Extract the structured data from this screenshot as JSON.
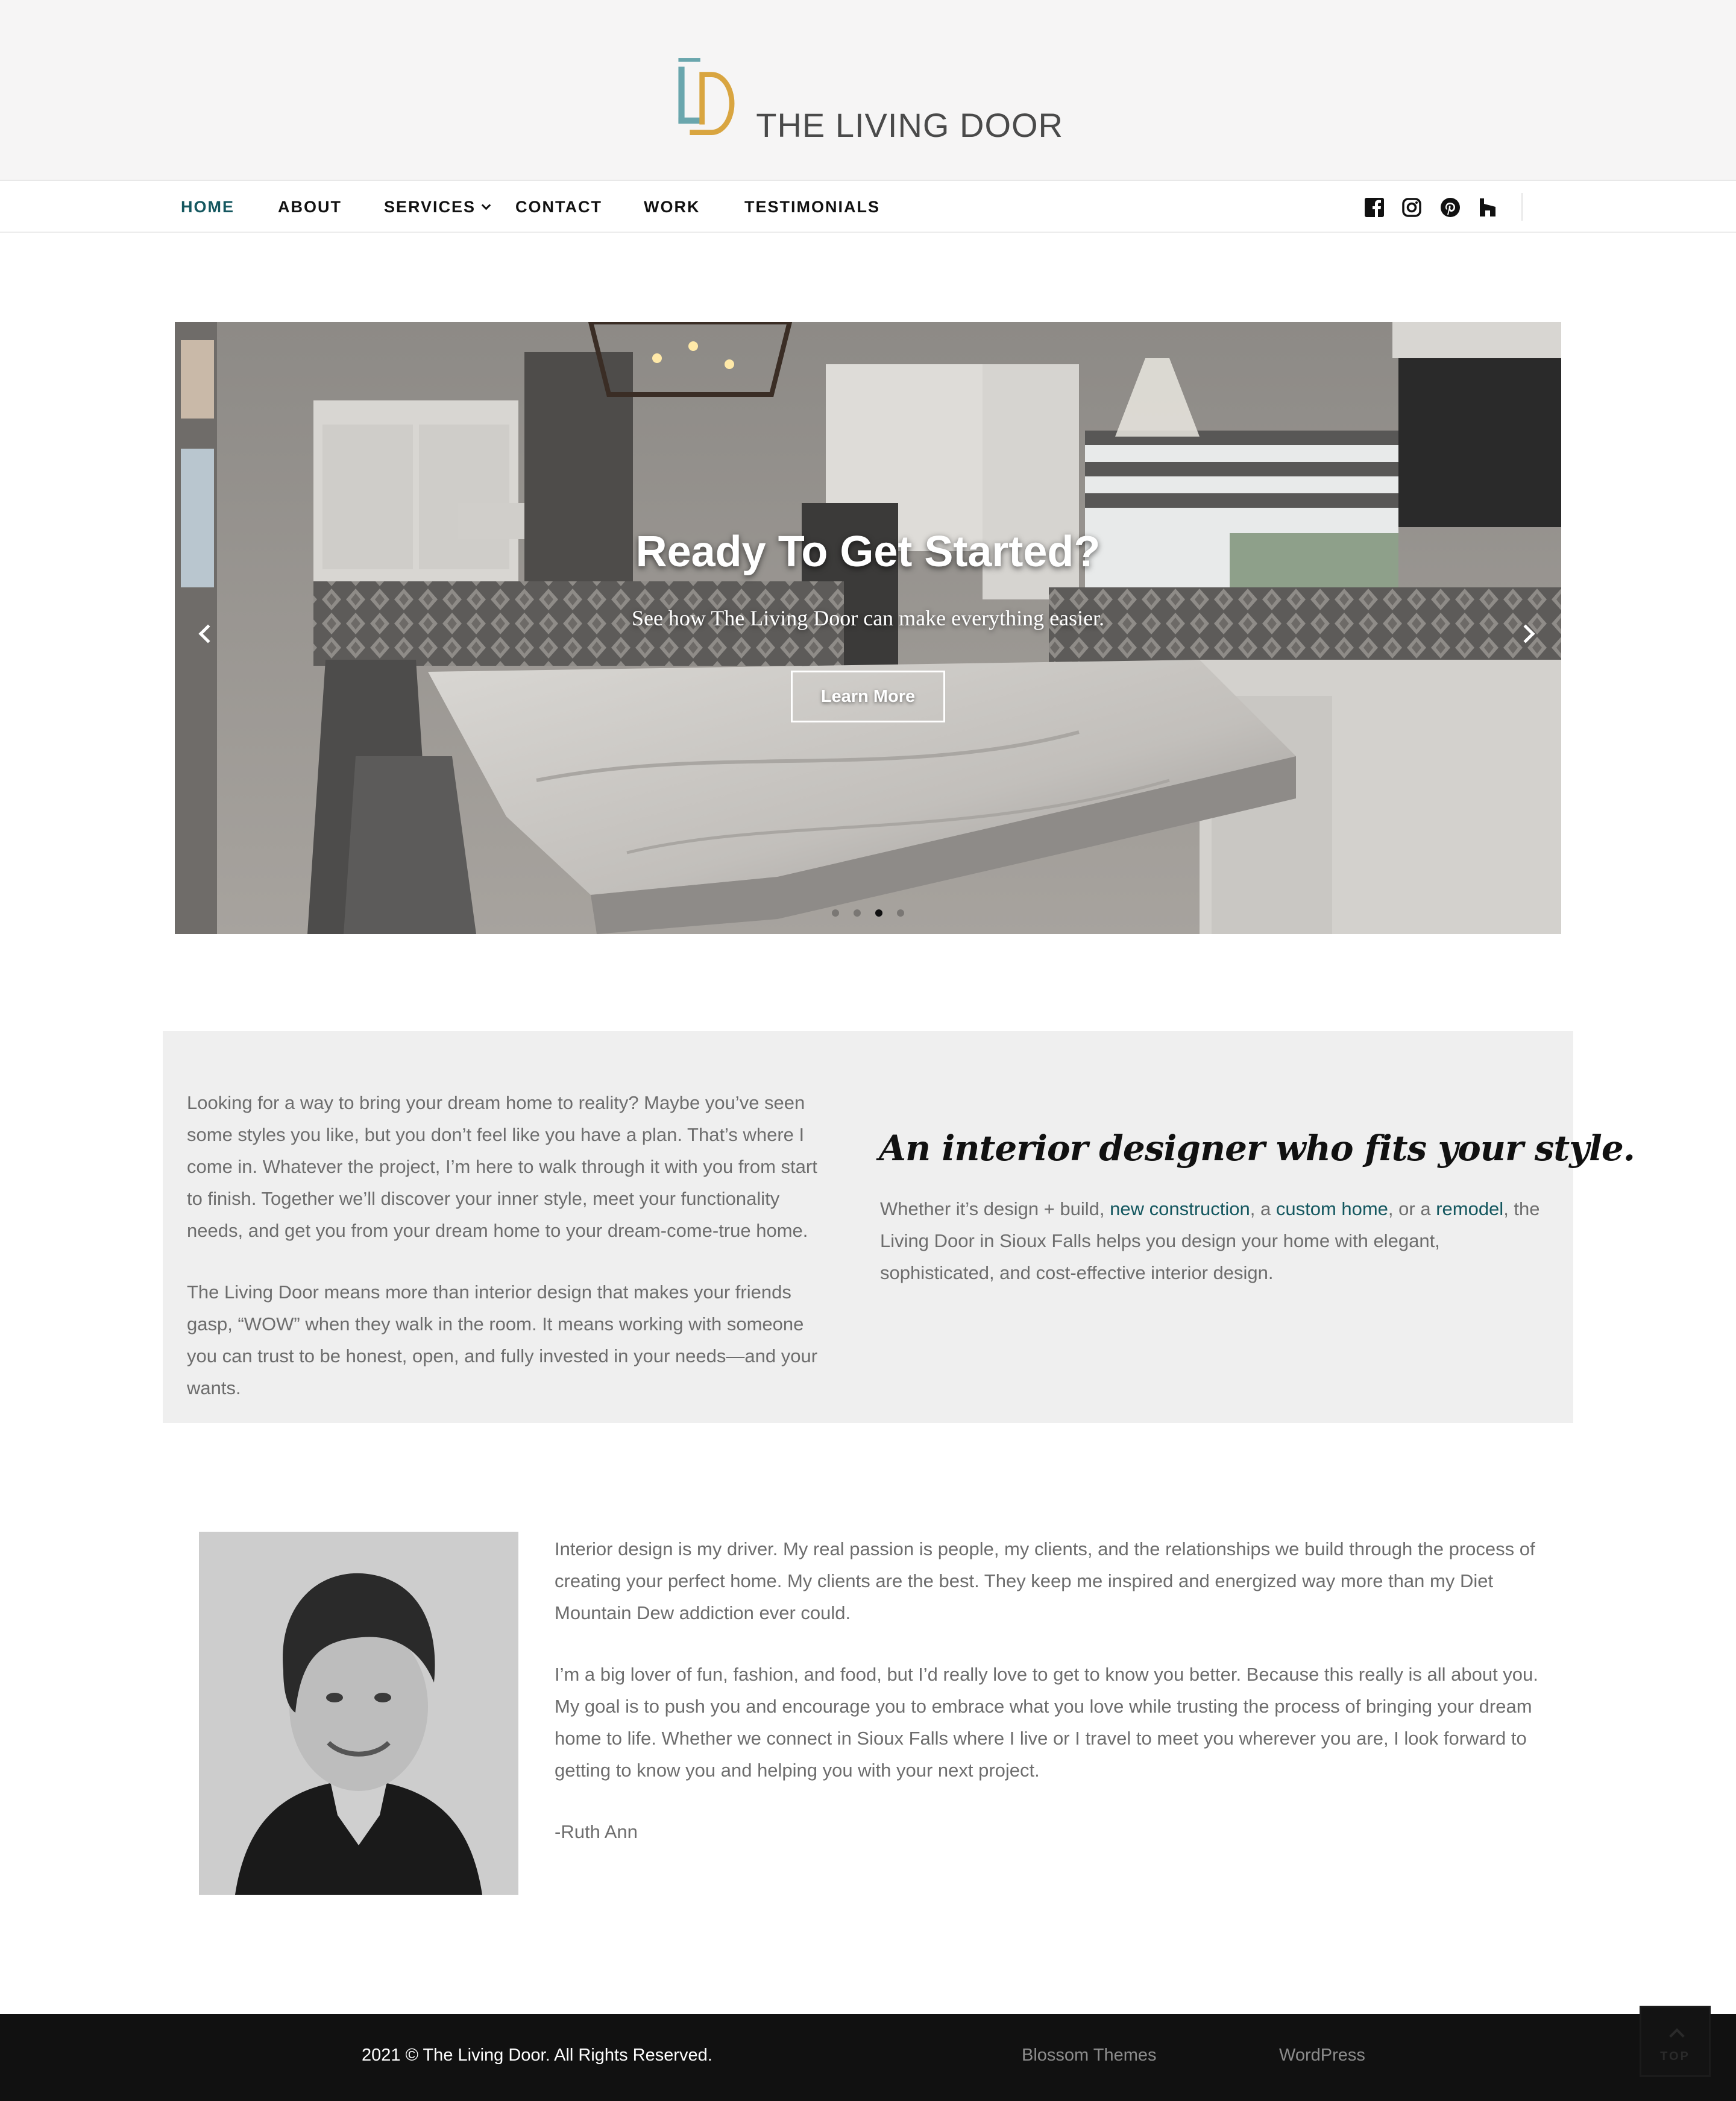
{
  "brand": {
    "name": "THE LIVING DOOR",
    "colors": {
      "teal": "#6aa6ad",
      "gold": "#d9a540",
      "accent": "#14575f"
    }
  },
  "nav": {
    "items": [
      {
        "label": "HOME",
        "active": true
      },
      {
        "label": "ABOUT"
      },
      {
        "label": "SERVICES",
        "has_dropdown": true
      },
      {
        "label": "CONTACT"
      },
      {
        "label": "WORK"
      },
      {
        "label": "TESTIMONIALS"
      }
    ],
    "social_icons": [
      "facebook-icon",
      "instagram-icon",
      "pinterest-icon",
      "houzz-icon"
    ]
  },
  "hero": {
    "title": "Ready To Get Started?",
    "subtitle": "See how The Living Door can make everything easier.",
    "button": "Learn More",
    "slide_count": 4,
    "active_slide": 3
  },
  "intro": {
    "left_paragraphs": [
      "Looking for a way to bring your dream home to reality? Maybe you’ve seen some styles you like, but you don’t feel like you have a plan. That’s where I come in. Whatever the project, I’m here to walk through it with you from start to finish. Together we’ll discover your inner style, meet your functionality needs, and get you from your dream home to your dream-come-true home.",
      "The Living Door means more than interior design that makes your friends gasp, “WOW” when they walk in the room. It means working with someone you can trust to be honest, open, and fully invested in your needs—and your wants."
    ],
    "heading": "An interior designer who fits your style.",
    "right_text": {
      "t1": "Whether it’s design + build, ",
      "link1": "new construction",
      "t2": ", a ",
      "link2": "custom home",
      "t3": ", or a ",
      "link3": "remodel",
      "t4": ", the Living Door in Sioux Falls helps you design your home with elegant, sophisticated, and cost-effective interior design."
    }
  },
  "about": {
    "paragraphs": [
      "Interior design is my driver. My real passion is people, my clients, and the relationships we build through the process of creating your perfect home. My clients are the best. They keep me inspired and energized way more than my Diet Mountain Dew addiction ever could.",
      "I’m a big lover of fun, fashion, and food, but I’d really love to get to know you better. Because this really is all about you. My goal is to push you and encourage you to embrace what you love while trusting the process of bringing your dream home to life. Whether we connect in Sioux Falls where I live or I travel to meet you wherever you are, I look forward to getting to know you and helping you with your next project.",
      "-Ruth Ann"
    ]
  },
  "footer": {
    "copyright": "2021 © The Living Door. All Rights Reserved.",
    "links": [
      "Blossom Themes",
      "WordPress"
    ],
    "top_label": "TOP"
  }
}
